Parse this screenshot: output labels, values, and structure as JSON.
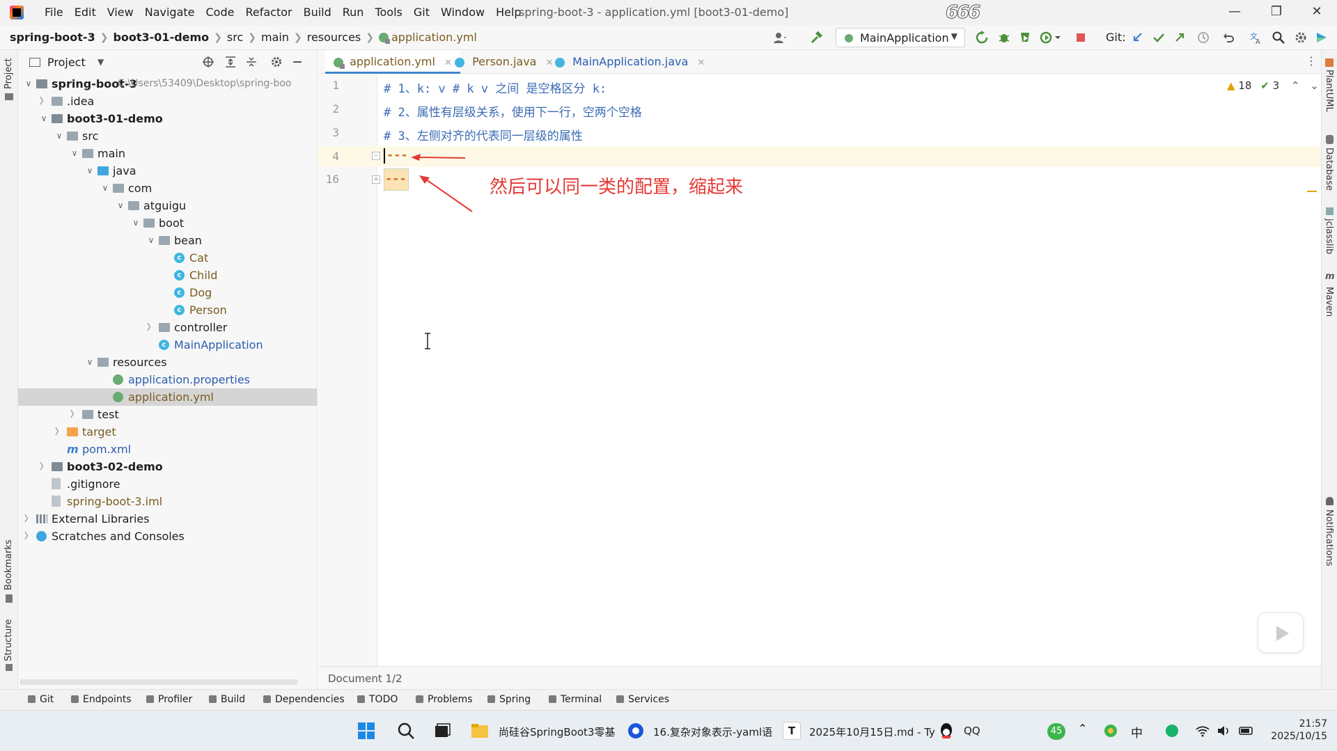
{
  "window": {
    "menu": [
      "File",
      "Edit",
      "View",
      "Navigate",
      "Code",
      "Refactor",
      "Build",
      "Run",
      "Tools",
      "Git",
      "Window",
      "Help"
    ],
    "title": "spring-boot-3 - application.yml [boot3-01-demo]",
    "badge": "666"
  },
  "breadcrumbs": [
    "spring-boot-3",
    "boot3-01-demo",
    "src",
    "main",
    "resources",
    "application.yml"
  ],
  "run_config": "MainApplication",
  "git_label": "Git:",
  "project_panel": {
    "title": "Project",
    "root_path": "C:\\Users\\53409\\Desktop\\spring-boo",
    "tree": [
      {
        "label": "spring-boot-3",
        "bold": true,
        "depth": 0,
        "arrow": "down",
        "icon": "module"
      },
      {
        "label": ".idea",
        "depth": 1,
        "arrow": "right",
        "icon": "folder"
      },
      {
        "label": "boot3-01-demo",
        "bold": true,
        "depth": 1,
        "arrow": "down",
        "icon": "module"
      },
      {
        "label": "src",
        "depth": 2,
        "arrow": "down",
        "icon": "folder"
      },
      {
        "label": "main",
        "depth": 3,
        "arrow": "down",
        "icon": "folder"
      },
      {
        "label": "java",
        "depth": 4,
        "arrow": "down",
        "icon": "folder-blue"
      },
      {
        "label": "com",
        "depth": 5,
        "arrow": "down",
        "icon": "folder"
      },
      {
        "label": "atguigu",
        "depth": 6,
        "arrow": "down",
        "icon": "folder"
      },
      {
        "label": "boot",
        "depth": 7,
        "arrow": "down",
        "icon": "folder"
      },
      {
        "label": "bean",
        "depth": 8,
        "arrow": "down",
        "icon": "folder"
      },
      {
        "label": "Cat",
        "depth": 9,
        "arrow": "",
        "icon": "class",
        "color": "#7a5b20"
      },
      {
        "label": "Child",
        "depth": 9,
        "arrow": "",
        "icon": "class",
        "color": "#7a5b20"
      },
      {
        "label": "Dog",
        "depth": 9,
        "arrow": "",
        "icon": "class",
        "color": "#7a5b20"
      },
      {
        "label": "Person",
        "depth": 9,
        "arrow": "",
        "icon": "class",
        "color": "#7a5b20"
      },
      {
        "label": "controller",
        "depth": 8,
        "arrow": "right",
        "icon": "folder"
      },
      {
        "label": "MainApplication",
        "depth": 8,
        "arrow": "",
        "icon": "class",
        "color": "#2a5db0"
      },
      {
        "label": "resources",
        "depth": 4,
        "arrow": "down",
        "icon": "folder"
      },
      {
        "label": "application.properties",
        "depth": 5,
        "arrow": "",
        "icon": "yml",
        "color": "#2a5db0"
      },
      {
        "label": "application.yml",
        "depth": 5,
        "arrow": "",
        "icon": "yml",
        "color": "#7a5b20",
        "selected": true
      },
      {
        "label": "test",
        "depth": 3,
        "arrow": "right",
        "icon": "folder"
      },
      {
        "label": "target",
        "depth": 2,
        "arrow": "right",
        "icon": "folder-orange",
        "color": "#7a5b20"
      },
      {
        "label": "pom.xml",
        "depth": 2,
        "arrow": "",
        "icon": "maven",
        "color": "#2a5db0"
      },
      {
        "label": "boot3-02-demo",
        "bold": true,
        "depth": 1,
        "arrow": "right",
        "icon": "module"
      },
      {
        "label": ".gitignore",
        "depth": 1,
        "arrow": "",
        "icon": "file"
      },
      {
        "label": "spring-boot-3.iml",
        "depth": 1,
        "arrow": "",
        "icon": "file",
        "color": "#7a5b20"
      },
      {
        "label": "External Libraries",
        "depth": 0,
        "arrow": "right",
        "icon": "lib"
      },
      {
        "label": "Scratches and Consoles",
        "depth": 0,
        "arrow": "right",
        "icon": "scratch"
      }
    ]
  },
  "tabs": [
    {
      "label": "application.yml",
      "active": true
    },
    {
      "label": "Person.java",
      "active": false
    },
    {
      "label": "MainApplication.java",
      "active": false
    }
  ],
  "editor": {
    "line_numbers": [
      "1",
      "2",
      "3",
      "4",
      "16"
    ],
    "lines": [
      "# 1、k: v # k v 之间 是空格区分 k:",
      "# 2、属性有层级关系，使用下一行，空两个空格",
      "# 3、左侧对齐的代表同一层级的属性",
      "---",
      "---"
    ],
    "annotation": "然后可以同一类的配置，缩起来",
    "warnings": "18",
    "checks": "3",
    "status": "Document 1/2"
  },
  "left_strip": [
    "Project",
    "Bookmarks",
    "Structure"
  ],
  "right_strip": [
    "PlantUML",
    "Database",
    "jclasslib",
    "Maven",
    "Notifications"
  ],
  "tool_windows": [
    "Git",
    "Endpoints",
    "Profiler",
    "Build",
    "Dependencies",
    "TODO",
    "Problems",
    "Spring",
    "Terminal",
    "Services"
  ],
  "taskbar": {
    "items": [
      "尚硅谷SpringBoot3零基",
      "16.复杂对象表示-yaml语",
      "2025年10月15日.md - Ty",
      "QQ"
    ],
    "tray_badge": "45",
    "ime": "中",
    "time": "21:57",
    "date": "2025/10/15"
  }
}
